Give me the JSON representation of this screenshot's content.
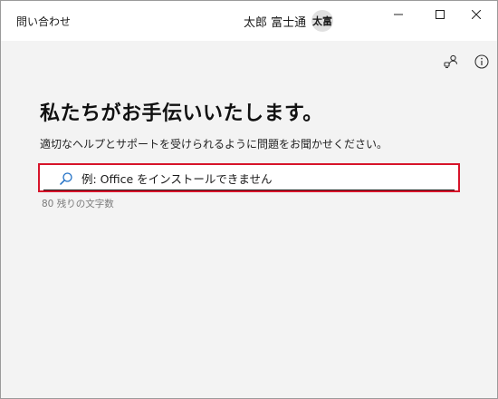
{
  "window": {
    "title": "問い合わせ",
    "user_name": "太郎 富士通",
    "avatar_initials": "太富",
    "controls": [
      "minimize",
      "maximize",
      "close"
    ]
  },
  "toolbar": {
    "icons": [
      "people-connect-icon",
      "info-icon"
    ]
  },
  "main": {
    "heading": "私たちがお手伝いいたします。",
    "description": "適切なヘルプとサポートを受けられるように問題をお聞かせください。",
    "search": {
      "placeholder": "例: Office をインストールできません",
      "value": "",
      "remaining_chars": "80 残りの文字数"
    }
  },
  "colors": {
    "highlight": "#d7142a",
    "background": "#f3f3f3",
    "titlebar": "#ffffff"
  }
}
